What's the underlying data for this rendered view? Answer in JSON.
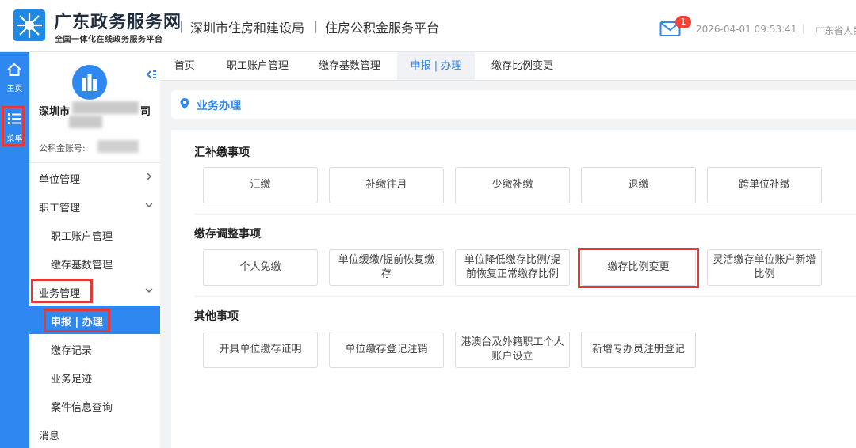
{
  "header": {
    "brand_title": "广东政务服务网",
    "brand_subtitle": "全国一体化在线政务服务平台",
    "separator": "|",
    "bureau": "深圳市住房和建设局",
    "platform": "住房公积金服务平台",
    "mail_badge": "1",
    "datetime": "2026-04-01 09:53:41",
    "separator2": "|",
    "region": "广东省人民"
  },
  "rail": {
    "home_label": "主页",
    "menu_label": "菜单"
  },
  "sidebar": {
    "org_name_prefix": "深圳市",
    "org_name_end": "司",
    "org_name_line2_end": "",
    "account_label": "公积金账号:",
    "items": [
      {
        "label": "单位管理"
      },
      {
        "label": "职工管理"
      },
      {
        "label": "职工账户管理"
      },
      {
        "label": "缴存基数管理"
      },
      {
        "label": "业务管理"
      },
      {
        "label": "申报 | 办理"
      },
      {
        "label": "缴存记录"
      },
      {
        "label": "业务足迹"
      },
      {
        "label": "案件信息查询"
      },
      {
        "label": "消息"
      }
    ]
  },
  "tabs": [
    {
      "label": "首页"
    },
    {
      "label": "职工账户管理"
    },
    {
      "label": "缴存基数管理"
    },
    {
      "label": "申报 | 办理"
    },
    {
      "label": "缴存比例变更"
    }
  ],
  "main": {
    "panel_title": "业务办理",
    "sections": [
      {
        "title": "汇补缴事项",
        "buttons": [
          {
            "label": "汇缴"
          },
          {
            "label": "补缴往月"
          },
          {
            "label": "少缴补缴"
          },
          {
            "label": "退缴"
          },
          {
            "label": "跨单位补缴"
          }
        ]
      },
      {
        "title": "缴存调整事项",
        "buttons": [
          {
            "label": "个人免缴"
          },
          {
            "label": "单位缓缴/提前恢复缴存"
          },
          {
            "label": "单位降低缴存比例/提前恢复正常缴存比例"
          },
          {
            "label": "缴存比例变更"
          },
          {
            "label": "灵活缴存单位账户新增比例"
          }
        ]
      },
      {
        "title": "其他事项",
        "buttons": [
          {
            "label": "开具单位缴存证明"
          },
          {
            "label": "单位缴存登记注销"
          },
          {
            "label": "港澳台及外籍职工个人账户设立"
          },
          {
            "label": "新增专办员注册登记"
          }
        ]
      }
    ]
  },
  "colors": {
    "accent": "#2f87f0",
    "highlight_box": "#e53935",
    "badge": "#f44336"
  }
}
